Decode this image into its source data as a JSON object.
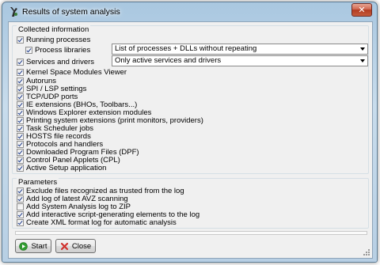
{
  "window": {
    "title": "Results of system analysis",
    "close_glyph": "✕"
  },
  "collected": {
    "title": "Collected information",
    "running": {
      "label": "Running processes",
      "checked": true
    },
    "libraries": {
      "label": "Process libraries",
      "checked": true,
      "option": "List of processes + DLLs without repeating"
    },
    "services": {
      "label": "Services and drivers",
      "checked": true,
      "option": "Only active services and drivers"
    },
    "items": [
      {
        "label": "Kernel Space Modules Viewer",
        "checked": true
      },
      {
        "label": "Autoruns",
        "checked": true
      },
      {
        "label": "SPI / LSP settings",
        "checked": true
      },
      {
        "label": "TCP/UDP ports",
        "checked": true
      },
      {
        "label": "IE extensions (BHOs, Toolbars...)",
        "checked": true
      },
      {
        "label": "Windows Explorer extension modules",
        "checked": true
      },
      {
        "label": "Printing system extensions (print monitors, providers)",
        "checked": true
      },
      {
        "label": "Task Scheduler jobs",
        "checked": true
      },
      {
        "label": "HOSTS file records",
        "checked": true
      },
      {
        "label": "Protocols and handlers",
        "checked": true
      },
      {
        "label": "Downloaded Program Files (DPF)",
        "checked": true
      },
      {
        "label": "Control Panel Applets (CPL)",
        "checked": true
      },
      {
        "label": "Active Setup application",
        "checked": true
      }
    ]
  },
  "parameters": {
    "title": "Parameters",
    "items": [
      {
        "label": "Exclude files recognized as trusted from the log",
        "checked": true
      },
      {
        "label": "Add log of latest AVZ scanning",
        "checked": true
      },
      {
        "label": "Add System Analysis log to ZIP",
        "checked": false
      },
      {
        "label": "Add interactive script-generating elements to the log",
        "checked": true
      },
      {
        "label": "Create XML format log for automatic analysis",
        "checked": true
      }
    ]
  },
  "buttons": {
    "start": "Start",
    "close": "Close"
  },
  "colors": {
    "start_icon": "#2f9b2f",
    "close_icon": "#d0312d",
    "title_close": "#c45a3c"
  }
}
